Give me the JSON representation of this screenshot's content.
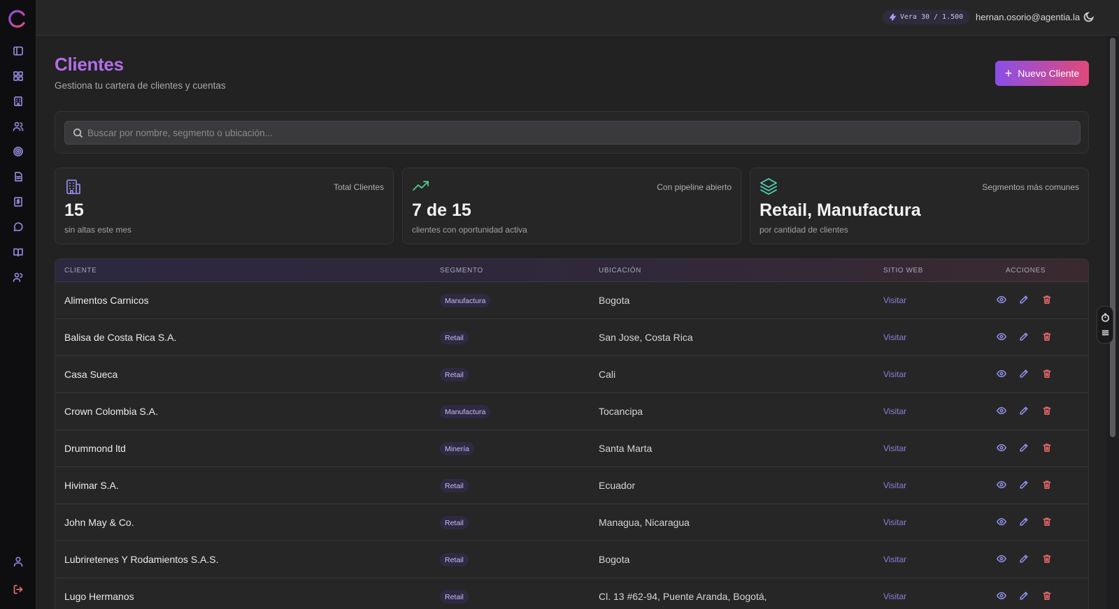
{
  "topbar": {
    "credits": "Vera 30 / 1.500",
    "user_email": "hernan.osorio@agentia.la"
  },
  "page": {
    "title": "Clientes",
    "subtitle": "Gestiona tu cartera de clientes y cuentas",
    "new_button": "Nuevo Cliente"
  },
  "search": {
    "placeholder": "Buscar por nombre, segmento o ubicación...",
    "value": ""
  },
  "stats": [
    {
      "label": "Total Clientes",
      "value": "15",
      "sub": "sin altas este mes",
      "icon": "building-icon",
      "color": "#8f87e0"
    },
    {
      "label": "Con pipeline abierto",
      "value": "7 de 15",
      "sub": "clientes con oportunidad activa",
      "icon": "trending-up-icon",
      "color": "#4fd18b"
    },
    {
      "label": "Segmentos más comunes",
      "value": "Retail, Manufactura",
      "sub": "por cantidad de clientes",
      "icon": "layers-icon",
      "color": "#4fd1b8"
    }
  ],
  "table": {
    "headers": {
      "client": "CLIENTE",
      "segment": "SEGMENTO",
      "location": "UBICACIÓN",
      "website": "SITIO WEB",
      "actions": "ACCIONES"
    },
    "rows": [
      {
        "name": "Alimentos Carnicos",
        "segment": "Manufactura",
        "location": "Bogota",
        "web": "Visitar"
      },
      {
        "name": "Balisa de Costa Rica S.A.",
        "segment": "Retail",
        "location": "San Jose, Costa Rica",
        "web": "Visitar"
      },
      {
        "name": "Casa Sueca",
        "segment": "Retail",
        "location": "Cali",
        "web": "Visitar"
      },
      {
        "name": "Crown Colombia S.A.",
        "segment": "Manufactura",
        "location": "Tocancipa",
        "web": "Visitar"
      },
      {
        "name": "Drummond ltd",
        "segment": "Minería",
        "location": "Santa Marta",
        "web": "Visitar"
      },
      {
        "name": "Hivimar S.A.",
        "segment": "Retail",
        "location": "Ecuador",
        "web": "Visitar"
      },
      {
        "name": "John May & Co.",
        "segment": "Retail",
        "location": "Managua, Nicaragua",
        "web": "Visitar"
      },
      {
        "name": "Lubriretenes Y Rodamientos S.A.S.",
        "segment": "Retail",
        "location": "Bogota",
        "web": "Visitar"
      },
      {
        "name": "Lugo Hermanos",
        "segment": "Retail",
        "location": "Cl. 13 #62-94, Puente Aranda, Bogotá,",
        "web": "Visitar"
      }
    ]
  },
  "colors": {
    "accent": "#b26ee8",
    "button_gradient_start": "#8a4fe6",
    "button_gradient_end": "#e0497a",
    "danger": "#e86868"
  }
}
